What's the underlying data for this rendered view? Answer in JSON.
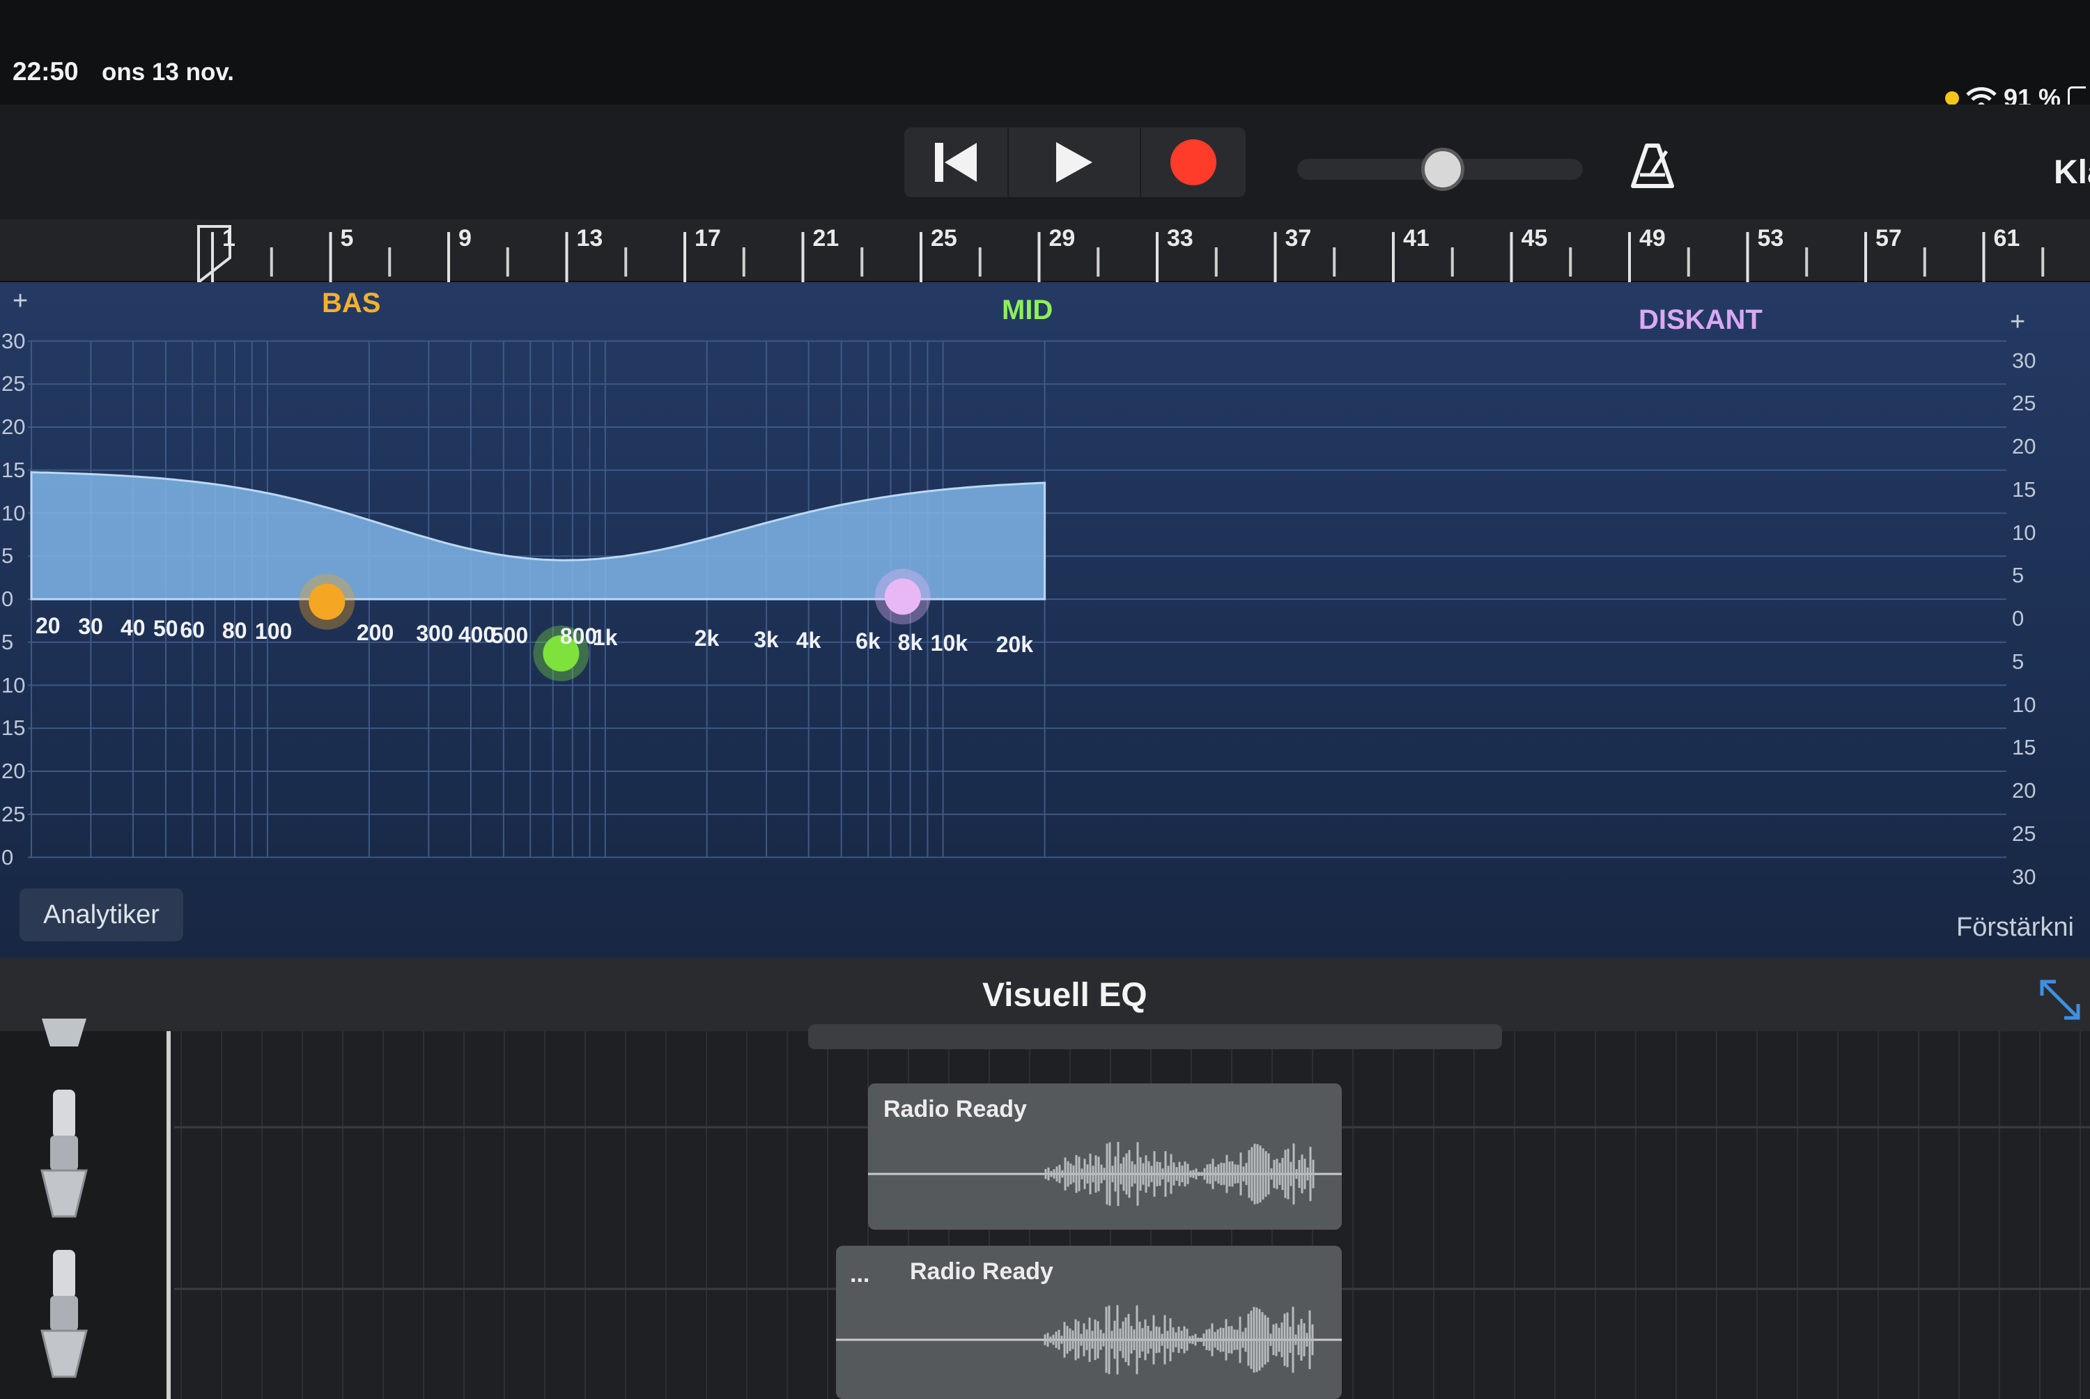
{
  "status_bar": {
    "time": "22:50",
    "date": "ons 13 nov.",
    "battery": "91 %"
  },
  "control_bar": {
    "right_title": "Kla"
  },
  "ruler": {
    "bars": [
      "1",
      "5",
      "9",
      "13",
      "17",
      "21",
      "25",
      "29",
      "33",
      "37",
      "41",
      "45",
      "49",
      "53",
      "57",
      "61"
    ]
  },
  "eq": {
    "bands": {
      "bas": "BAS",
      "mid": "MID",
      "diskant": "DISKANT"
    },
    "plus": "+",
    "db_left_top": [
      "30",
      "25",
      "20",
      "15",
      "10",
      "5",
      "0"
    ],
    "db_left_bottom": [
      "5",
      "10",
      "15",
      "20",
      "25",
      "0"
    ],
    "db_right": [
      "30",
      "25",
      "20",
      "15",
      "10",
      "5",
      "0",
      "5",
      "10",
      "15",
      "20",
      "25",
      "30"
    ],
    "freq_labels": [
      "20",
      "30",
      "40",
      "50",
      "60",
      "80",
      "100",
      "200",
      "300",
      "400",
      "500",
      "800",
      "1k",
      "2k",
      "3k",
      "4k",
      "6k",
      "8k",
      "10k",
      "20k"
    ],
    "analyzer_button": "Analytiker",
    "gain_label": "Förstärkni",
    "colors": {
      "bas": "#f5a623",
      "mid": "#7ee13c",
      "diskant": "#e8b8f5",
      "curve_fill": "#7fb5e8"
    }
  },
  "panel_title": "Visuell EQ",
  "tracks": {
    "regions": [
      {
        "name": "Radio Ready"
      },
      {
        "name": "Radio Ready",
        "menu": "..."
      }
    ]
  }
}
